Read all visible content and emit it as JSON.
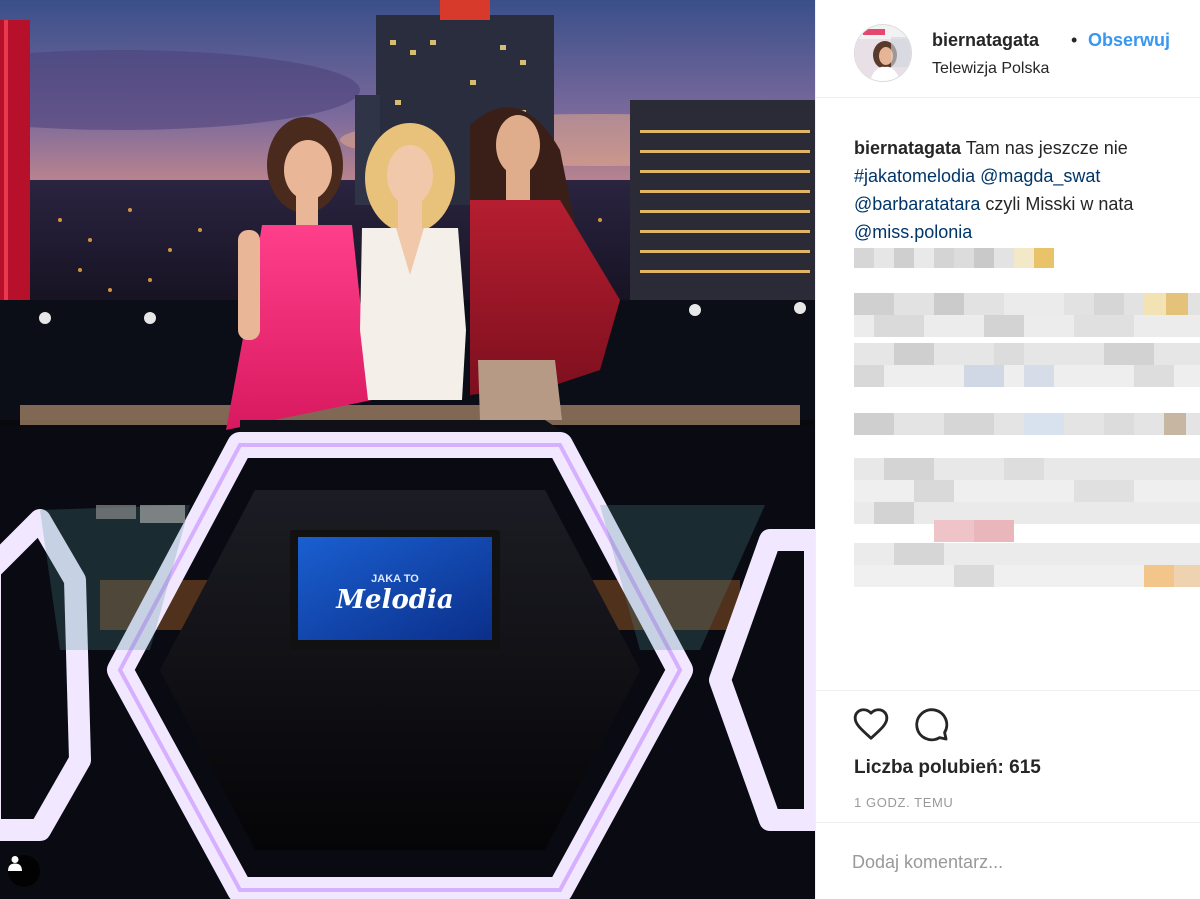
{
  "post": {
    "username": "biernatagata",
    "separator": "•",
    "follow_label": "Obserwuj",
    "location": "Telewizja Polska",
    "photo_screen_text": {
      "line1": "JAKA TO",
      "line2": "Melodia"
    }
  },
  "caption": {
    "username": "biernatagata",
    "text_line1": " Tam nas jeszcze nie",
    "hashtag": "#jakatomelodia",
    "mention1": " @magda_swat",
    "mention2": "@barbaratatara",
    "text_line3": " czyli Misski w nata",
    "mention3": "@miss.polonia"
  },
  "engagement": {
    "likes_label": "Liczba polubień: 615",
    "timestamp": "1 GODZ. TEMU"
  },
  "comment": {
    "placeholder": "Dodaj komentarz..."
  },
  "icons": {
    "like": "heart-icon",
    "comment": "comment-bubble-icon",
    "tag": "person-tag-icon"
  },
  "colors": {
    "accent_link": "#3897f0",
    "mention_link": "#003569",
    "muted": "#999999",
    "text": "#262626",
    "divider": "#efefef"
  }
}
